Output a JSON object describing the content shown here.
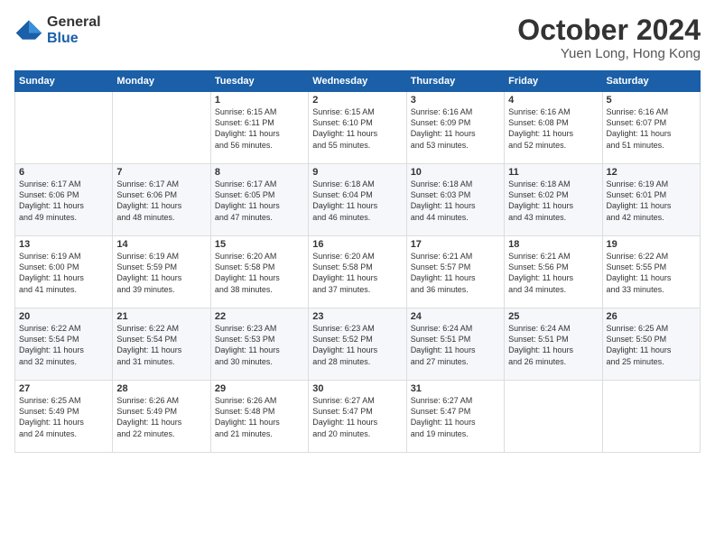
{
  "logo": {
    "general": "General",
    "blue": "Blue"
  },
  "title": "October 2024",
  "subtitle": "Yuen Long, Hong Kong",
  "header_days": [
    "Sunday",
    "Monday",
    "Tuesday",
    "Wednesday",
    "Thursday",
    "Friday",
    "Saturday"
  ],
  "weeks": [
    [
      {
        "day": "",
        "info": ""
      },
      {
        "day": "",
        "info": ""
      },
      {
        "day": "1",
        "info": "Sunrise: 6:15 AM\nSunset: 6:11 PM\nDaylight: 11 hours\nand 56 minutes."
      },
      {
        "day": "2",
        "info": "Sunrise: 6:15 AM\nSunset: 6:10 PM\nDaylight: 11 hours\nand 55 minutes."
      },
      {
        "day": "3",
        "info": "Sunrise: 6:16 AM\nSunset: 6:09 PM\nDaylight: 11 hours\nand 53 minutes."
      },
      {
        "day": "4",
        "info": "Sunrise: 6:16 AM\nSunset: 6:08 PM\nDaylight: 11 hours\nand 52 minutes."
      },
      {
        "day": "5",
        "info": "Sunrise: 6:16 AM\nSunset: 6:07 PM\nDaylight: 11 hours\nand 51 minutes."
      }
    ],
    [
      {
        "day": "6",
        "info": "Sunrise: 6:17 AM\nSunset: 6:06 PM\nDaylight: 11 hours\nand 49 minutes."
      },
      {
        "day": "7",
        "info": "Sunrise: 6:17 AM\nSunset: 6:06 PM\nDaylight: 11 hours\nand 48 minutes."
      },
      {
        "day": "8",
        "info": "Sunrise: 6:17 AM\nSunset: 6:05 PM\nDaylight: 11 hours\nand 47 minutes."
      },
      {
        "day": "9",
        "info": "Sunrise: 6:18 AM\nSunset: 6:04 PM\nDaylight: 11 hours\nand 46 minutes."
      },
      {
        "day": "10",
        "info": "Sunrise: 6:18 AM\nSunset: 6:03 PM\nDaylight: 11 hours\nand 44 minutes."
      },
      {
        "day": "11",
        "info": "Sunrise: 6:18 AM\nSunset: 6:02 PM\nDaylight: 11 hours\nand 43 minutes."
      },
      {
        "day": "12",
        "info": "Sunrise: 6:19 AM\nSunset: 6:01 PM\nDaylight: 11 hours\nand 42 minutes."
      }
    ],
    [
      {
        "day": "13",
        "info": "Sunrise: 6:19 AM\nSunset: 6:00 PM\nDaylight: 11 hours\nand 41 minutes."
      },
      {
        "day": "14",
        "info": "Sunrise: 6:19 AM\nSunset: 5:59 PM\nDaylight: 11 hours\nand 39 minutes."
      },
      {
        "day": "15",
        "info": "Sunrise: 6:20 AM\nSunset: 5:58 PM\nDaylight: 11 hours\nand 38 minutes."
      },
      {
        "day": "16",
        "info": "Sunrise: 6:20 AM\nSunset: 5:58 PM\nDaylight: 11 hours\nand 37 minutes."
      },
      {
        "day": "17",
        "info": "Sunrise: 6:21 AM\nSunset: 5:57 PM\nDaylight: 11 hours\nand 36 minutes."
      },
      {
        "day": "18",
        "info": "Sunrise: 6:21 AM\nSunset: 5:56 PM\nDaylight: 11 hours\nand 34 minutes."
      },
      {
        "day": "19",
        "info": "Sunrise: 6:22 AM\nSunset: 5:55 PM\nDaylight: 11 hours\nand 33 minutes."
      }
    ],
    [
      {
        "day": "20",
        "info": "Sunrise: 6:22 AM\nSunset: 5:54 PM\nDaylight: 11 hours\nand 32 minutes."
      },
      {
        "day": "21",
        "info": "Sunrise: 6:22 AM\nSunset: 5:54 PM\nDaylight: 11 hours\nand 31 minutes."
      },
      {
        "day": "22",
        "info": "Sunrise: 6:23 AM\nSunset: 5:53 PM\nDaylight: 11 hours\nand 30 minutes."
      },
      {
        "day": "23",
        "info": "Sunrise: 6:23 AM\nSunset: 5:52 PM\nDaylight: 11 hours\nand 28 minutes."
      },
      {
        "day": "24",
        "info": "Sunrise: 6:24 AM\nSunset: 5:51 PM\nDaylight: 11 hours\nand 27 minutes."
      },
      {
        "day": "25",
        "info": "Sunrise: 6:24 AM\nSunset: 5:51 PM\nDaylight: 11 hours\nand 26 minutes."
      },
      {
        "day": "26",
        "info": "Sunrise: 6:25 AM\nSunset: 5:50 PM\nDaylight: 11 hours\nand 25 minutes."
      }
    ],
    [
      {
        "day": "27",
        "info": "Sunrise: 6:25 AM\nSunset: 5:49 PM\nDaylight: 11 hours\nand 24 minutes."
      },
      {
        "day": "28",
        "info": "Sunrise: 6:26 AM\nSunset: 5:49 PM\nDaylight: 11 hours\nand 22 minutes."
      },
      {
        "day": "29",
        "info": "Sunrise: 6:26 AM\nSunset: 5:48 PM\nDaylight: 11 hours\nand 21 minutes."
      },
      {
        "day": "30",
        "info": "Sunrise: 6:27 AM\nSunset: 5:47 PM\nDaylight: 11 hours\nand 20 minutes."
      },
      {
        "day": "31",
        "info": "Sunrise: 6:27 AM\nSunset: 5:47 PM\nDaylight: 11 hours\nand 19 minutes."
      },
      {
        "day": "",
        "info": ""
      },
      {
        "day": "",
        "info": ""
      }
    ]
  ]
}
